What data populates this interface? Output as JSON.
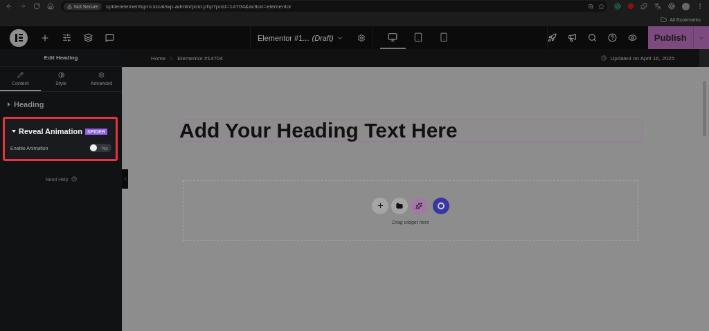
{
  "browser": {
    "security": "Not Secure",
    "url": "spiderelementspro.local/wp-admin/post.php?post=14704&action=elementor",
    "bookmarks": "All Bookmarks"
  },
  "topbar": {
    "document_title": "Elementor #1...",
    "status": "(Draft)",
    "devices": [
      {
        "kind": "desktop",
        "selected": true
      },
      {
        "kind": "tablet",
        "selected": false
      },
      {
        "kind": "mobile",
        "selected": false
      }
    ],
    "publish": "Publish"
  },
  "sidebar": {
    "title": "Edit Heading",
    "tabs": [
      {
        "kind": "content",
        "label": "Content",
        "selected": true
      },
      {
        "kind": "style",
        "label": "Style",
        "selected": false
      },
      {
        "kind": "advanced",
        "label": "Advanced",
        "selected": false
      }
    ],
    "sections": [
      {
        "title": "Heading",
        "expanded": false,
        "highlighted": false
      },
      {
        "title": "Reveal Animation",
        "badge": "SPIDER",
        "expanded": true,
        "highlighted": true,
        "controls": [
          {
            "label": "Enable Animation",
            "on": false,
            "state_text": "No"
          }
        ]
      }
    ],
    "help": "Need Help"
  },
  "breadcrumb": [
    "Home",
    "Elementor #14704"
  ],
  "updated": "Updated on April 16, 2025",
  "canvas": {
    "heading": "Add Your Heading Text Here",
    "drop_hint": "Drag widget here"
  }
}
